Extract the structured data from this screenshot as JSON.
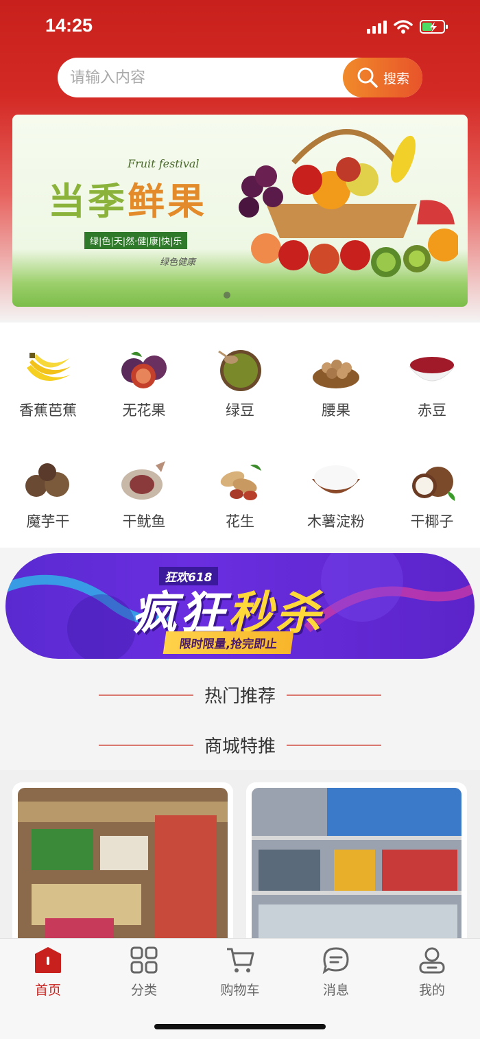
{
  "status_bar": {
    "time": "14:25"
  },
  "search": {
    "placeholder": "请输入内容",
    "button_label": "搜索"
  },
  "banner": {
    "title_part1": "当季",
    "title_part2": "鲜果",
    "subtitle_en": "Fruit festival",
    "tagline": "绿|色|天|然·健|康|快|乐",
    "signature": "绿色健康"
  },
  "categories": [
    {
      "label": "香蕉芭蕉",
      "icon": "banana-icon"
    },
    {
      "label": "无花果",
      "icon": "fig-icon"
    },
    {
      "label": "绿豆",
      "icon": "mung-bean-icon"
    },
    {
      "label": "腰果",
      "icon": "cashew-icon"
    },
    {
      "label": "赤豆",
      "icon": "red-bean-icon"
    },
    {
      "label": "魔芋干",
      "icon": "konjac-icon"
    },
    {
      "label": "干鱿鱼",
      "icon": "squid-icon"
    },
    {
      "label": "花生",
      "icon": "peanut-icon"
    },
    {
      "label": "木薯淀粉",
      "icon": "starch-icon"
    },
    {
      "label": "干椰子",
      "icon": "coconut-icon"
    }
  ],
  "promo": {
    "sub": "狂欢618",
    "main_part1": "疯狂",
    "main_part2": "秒杀",
    "ribbon": "限时限量,抢完即止"
  },
  "sections": {
    "hot": "热门推荐",
    "mall": "商城特推"
  },
  "tabbar": [
    {
      "label": "首页",
      "icon": "home-icon",
      "active": true
    },
    {
      "label": "分类",
      "icon": "category-icon",
      "active": false
    },
    {
      "label": "购物车",
      "icon": "cart-icon",
      "active": false
    },
    {
      "label": "消息",
      "icon": "message-icon",
      "active": false
    },
    {
      "label": "我的",
      "icon": "user-icon",
      "active": false
    }
  ],
  "colors": {
    "brand_red": "#c8201c",
    "search_orange": "#e8542a",
    "promo_purple": "#5a2ad0"
  }
}
